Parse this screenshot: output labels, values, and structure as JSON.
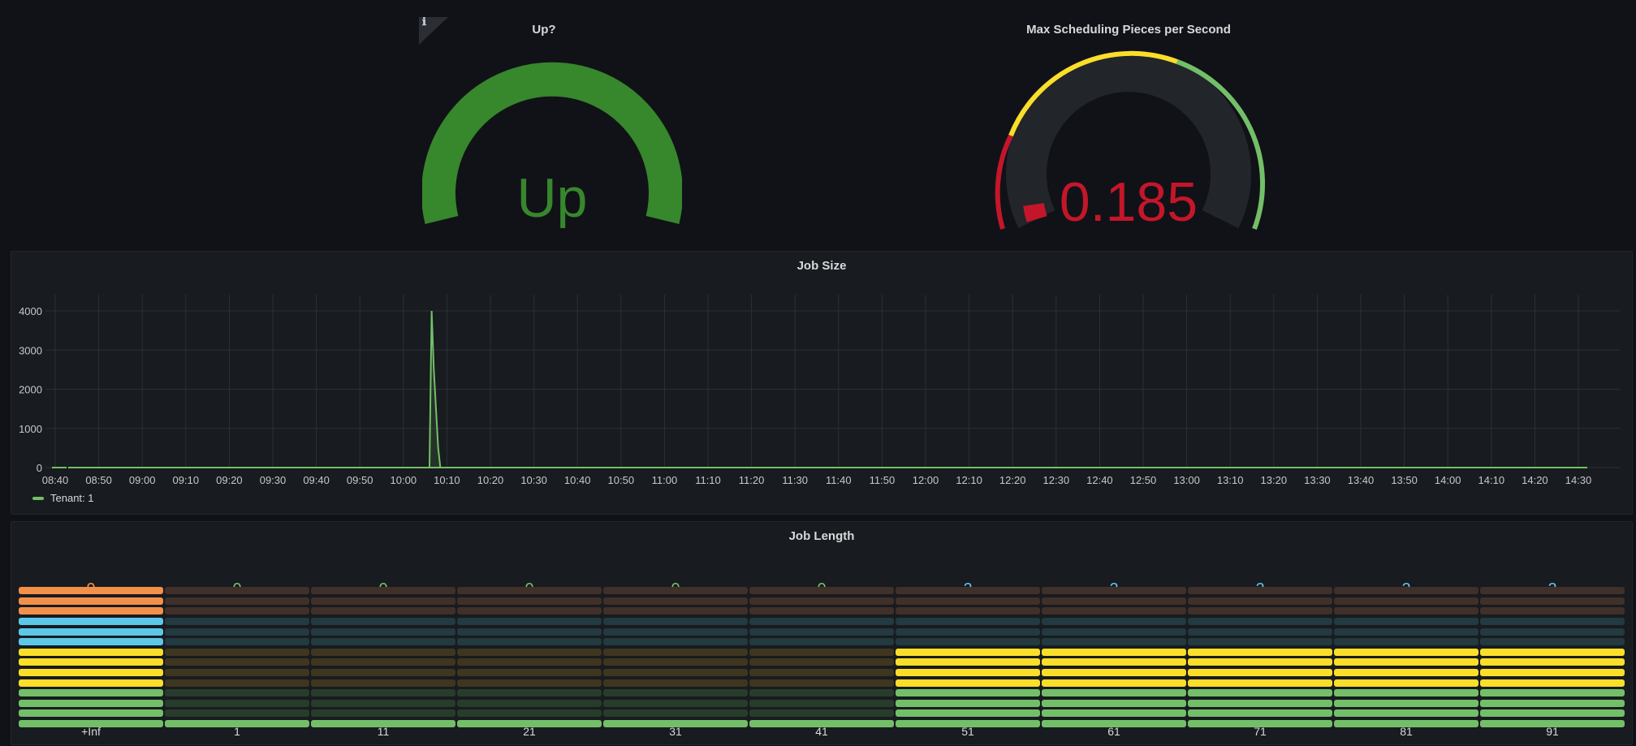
{
  "gauges": [
    {
      "title": "Up?",
      "value": "Up",
      "value_color": "#37872d",
      "has_info_icon": true,
      "info_icon": "info-icon"
    },
    {
      "title": "Max Scheduling Pieces per Second",
      "value": "0.185",
      "value_color": "#c4162a",
      "threshold_colors": [
        "#c4162a",
        "#fade2a",
        "#73bf69"
      ]
    }
  ],
  "job_size": {
    "title": "Job Size",
    "chart_data": {
      "type": "line",
      "title": "Job Size",
      "y_ticks": [
        "0",
        "1000",
        "2000",
        "3000",
        "4000"
      ],
      "ylim": [
        0,
        4000
      ],
      "x_ticks": [
        "08:40",
        "08:50",
        "09:00",
        "09:10",
        "09:20",
        "09:30",
        "09:40",
        "09:50",
        "10:00",
        "10:10",
        "10:20",
        "10:30",
        "10:40",
        "10:50",
        "11:00",
        "11:10",
        "11:20",
        "11:30",
        "11:40",
        "11:50",
        "12:00",
        "12:10",
        "12:20",
        "12:30",
        "12:40",
        "12:50",
        "13:00",
        "13:10",
        "13:20",
        "13:30",
        "13:40",
        "13:50",
        "14:00",
        "14:10",
        "14:20",
        "14:30"
      ],
      "grid": true,
      "legend": "bottom-left",
      "series": [
        {
          "name": "Tenant: 1",
          "color": "#73bf69",
          "x": [
            "10:06",
            "10:06:30",
            "10:07",
            "10:07:30",
            "10:08",
            "10:08:30",
            "10:09"
          ],
          "values": [
            0,
            4000,
            2500,
            1500,
            500,
            0,
            0
          ]
        }
      ]
    }
  },
  "job_length": {
    "title": "Job Length",
    "chart_data": {
      "type": "bar",
      "title": "Job Length",
      "categories": [
        "+Inf",
        "1",
        "11",
        "21",
        "31",
        "41",
        "51",
        "61",
        "71",
        "81",
        "91"
      ],
      "values": [
        9,
        0,
        0,
        0,
        0,
        0,
        2,
        2,
        2,
        2,
        2
      ],
      "colors": [
        "#f2904a",
        "#73bf69",
        "#73bf69",
        "#73bf69",
        "#73bf69",
        "#73bf69",
        "#5cc8e8",
        "#5cc8e8",
        "#5cc8e8",
        "#5cc8e8",
        "#5cc8e8"
      ]
    }
  }
}
